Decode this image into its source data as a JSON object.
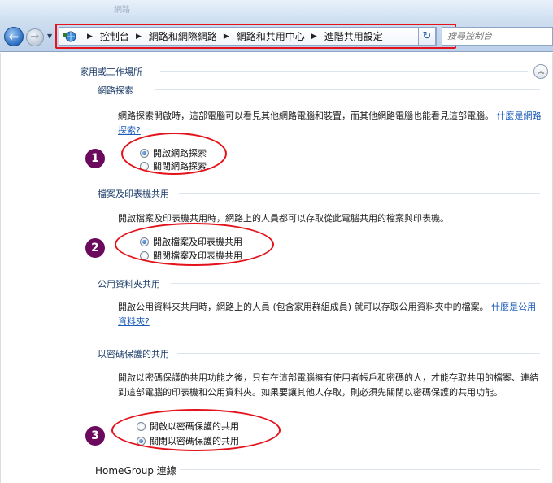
{
  "window": {
    "caption": "網路"
  },
  "nav": {
    "back_glyph": "←",
    "forward_glyph": "→",
    "history_glyph": "▼"
  },
  "breadcrumbs": [
    {
      "label": "控制台"
    },
    {
      "label": "網路和網際網路"
    },
    {
      "label": "網路和共用中心"
    },
    {
      "label": "進階共用設定"
    }
  ],
  "search": {
    "placeholder": "搜尋控制台"
  },
  "profile": {
    "title": "家用或工作場所",
    "collapse_glyph": "︽"
  },
  "sections": {
    "discovery": {
      "title": "網路探索",
      "desc": "網路探索開啟時，這部電腦可以看見其他網路電腦和裝置，而其他網路電腦也能看見這部電腦。",
      "link": "什麼是網路探索?",
      "options": [
        "開啟網路探索",
        "關閉網路探索"
      ],
      "selected": 0,
      "badge": "1"
    },
    "file_printer": {
      "title": "檔案及印表機共用",
      "desc": "開啟檔案及印表機共用時，網路上的人員都可以存取從此電腦共用的檔案與印表機。",
      "options": [
        "開啟檔案及印表機共用",
        "關閉檔案及印表機共用"
      ],
      "selected": 0,
      "badge": "2"
    },
    "public_folder": {
      "title": "公用資料夾共用",
      "desc": "開啟公用資料夾共用時，網路上的人員 (包含家用群組成員) 就可以存取公用資料夾中的檔案。",
      "link": "什麼是公用資料夾?"
    },
    "password": {
      "title": "以密碼保護的共用",
      "desc": "開啟以密碼保護的共用功能之後，只有在這部電腦擁有使用者帳戶和密碼的人，才能存取共用的檔案、連結到這部電腦的印表機和公用資料夾。如果要讓其他人存取，則必須先關閉以密碼保護的共用功能。",
      "options": [
        "開啟以密碼保護的共用",
        "關閉以密碼保護的共用"
      ],
      "selected": 1,
      "badge": "3"
    },
    "homegroup": {
      "title": "HomeGroup 連線"
    }
  },
  "colors": {
    "annotation": "#e3121b",
    "badge": "#6b0a5c",
    "link": "#1a5bb8"
  }
}
